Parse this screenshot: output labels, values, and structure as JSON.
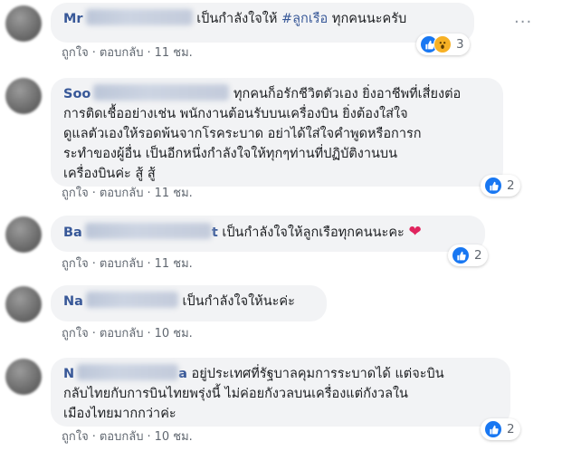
{
  "comments": [
    {
      "author_visible": "Mr",
      "author_tail": "",
      "text_pre": "เป็นกำลังใจให้ ",
      "hashtag": "#ลูกเรือ",
      "text_post": " ทุกคนนะครับ",
      "meta": {
        "like": "ถูกใจ",
        "reply": "ตอบกลับ",
        "time": "11 ชม."
      },
      "reactions": {
        "icons": [
          "like-icon",
          "wow-icon"
        ],
        "count": "3"
      },
      "more": "···"
    },
    {
      "author_visible": "Soo",
      "author_tail": "",
      "text_lines": [
        "ทุกคนก็อรักชีวิตตัวเอง ยิ่งอาชีพที่เสี่ยงต่อ",
        "การติดเชื้ออย่างเช่น พนักงานต้อนรับบนเครื่องบิน ยิ่งต้องใส่ใจ",
        "ดูแลตัวเองให้รอดพ้นจากโรคระบาด อย่าได้ใส่ใจคำพูดหรือการก",
        "ระทำของผู้อื่น เป็นอีกหนึ่งกำลังใจให้ทุกๆท่านที่ปฏิบัติงานบน",
        "เครื่องบินค่ะ สู้ สู้"
      ],
      "meta": {
        "like": "ถูกใจ",
        "reply": "ตอบกลับ",
        "time": "11 ชม."
      },
      "reactions": {
        "icons": [
          "like-icon"
        ],
        "count": "2"
      }
    },
    {
      "author_visible": "Ba",
      "author_tail": "t",
      "text": "เป็นกำลังใจให้ลูกเรือทุกคนนะคะ",
      "emoji": "❤",
      "meta": {
        "like": "ถูกใจ",
        "reply": "ตอบกลับ",
        "time": "11 ชม."
      },
      "reactions": {
        "icons": [
          "like-icon"
        ],
        "count": "2"
      }
    },
    {
      "author_visible": "Na",
      "author_tail": "",
      "text": "เป็นกำลังใจให้นะค่ะ",
      "meta": {
        "like": "ถูกใจ",
        "reply": "ตอบกลับ",
        "time": "10 ชม."
      }
    },
    {
      "author_visible": "N",
      "author_tail": "a",
      "text_lines": [
        "อยู่ประเทศที่รัฐบาลคุมการระบาดได้ แต่จะบิน",
        "กลับไทยกับการบินไทยพรุ่งนี้ ไม่ค่อยกังวลบนเครื่องแต่กังวลใน",
        "เมืองไทยมากกว่าค่ะ"
      ],
      "meta": {
        "like": "ถูกใจ",
        "reply": "ตอบกลับ",
        "time": "10 ชม."
      },
      "reactions": {
        "icons": [
          "like-icon"
        ],
        "count": "2"
      }
    }
  ],
  "colors": {
    "author": "#385898",
    "bubble": "#f2f3f5",
    "meta": "#606770",
    "like": "#1877f2",
    "wow": "#f7b125",
    "heart": "#e0245e"
  }
}
